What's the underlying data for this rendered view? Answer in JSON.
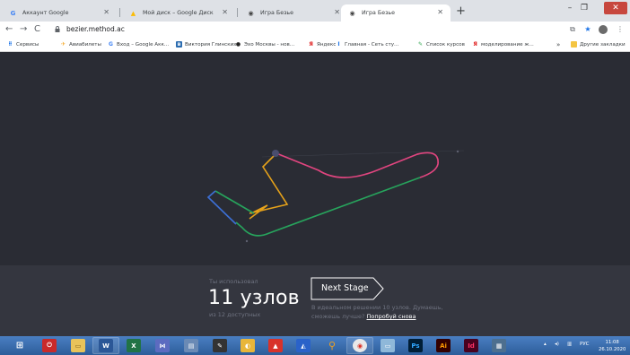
{
  "browser": {
    "tabs": [
      {
        "title": "Аккаунт Google",
        "favicon": "G",
        "color": "#4285f4",
        "active": false
      },
      {
        "title": "Мой диск – Google Диск",
        "favicon": "▲",
        "color": "#fbbc04",
        "active": false
      },
      {
        "title": "Игра Безье",
        "favicon": "◉",
        "color": "#444444",
        "active": false
      },
      {
        "title": "Игра Безье",
        "favicon": "◉",
        "color": "#444444",
        "active": true
      }
    ],
    "new_tab_label": "+",
    "url": "bezier.method.ac",
    "bookmarks": [
      {
        "label": "Сервисы",
        "icon": "⠿",
        "color": "#1a73e8"
      },
      {
        "label": "Авиабилеты",
        "icon": "✈",
        "color": "#f5a623"
      },
      {
        "label": "Вход – Google Акк...",
        "icon": "G",
        "color": "#4285f4"
      },
      {
        "label": "Виктория Глинских",
        "icon": "в",
        "color": "#2b6cb0"
      },
      {
        "label": "Эхо Москвы - нов...",
        "icon": "●",
        "color": "#222222"
      },
      {
        "label": "Яндекс",
        "icon": "Я",
        "color": "#e02020"
      },
      {
        "label": "Главная - Сеть сту...",
        "icon": "I",
        "color": "#1a73e8"
      },
      {
        "label": "Список курсов",
        "icon": "✎",
        "color": "#34a853"
      },
      {
        "label": "моделирование ж...",
        "icon": "Я",
        "color": "#e02020"
      }
    ],
    "bookmarks_overflow": "»",
    "other_bookmarks": "Другие закладки"
  },
  "game": {
    "used_label": "Ты использовал",
    "nodes_count": "11 узлов",
    "available_label": "из 12 доступных",
    "next_stage_label": "Next Stage",
    "ideal_text": "В идеальном решении 10 узлов. Думаешь, сможешь лучше?",
    "try_again_label": "Попробуй снова"
  },
  "colors": {
    "pink": "#e0457f",
    "green": "#27a35c",
    "blue": "#3c6fd4",
    "orange": "#e6a21a",
    "bg": "#2a2c34",
    "panel": "#34363f"
  },
  "taskbar": {
    "tray_language": "РУС",
    "time": "11:08",
    "date": "26.10.2020"
  }
}
